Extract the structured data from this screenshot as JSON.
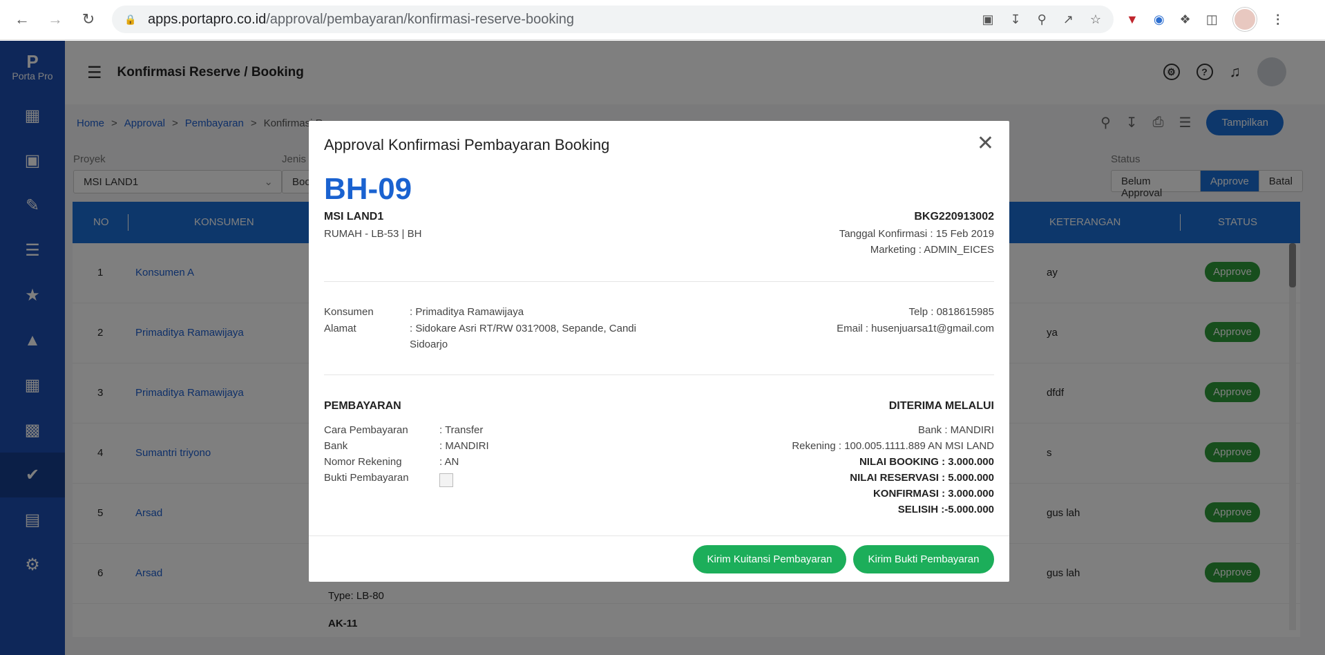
{
  "browser": {
    "url_host": "apps.portapro.co.id",
    "url_path": "/approval/pembayaran/konfirmasi-reserve-booking"
  },
  "app": {
    "logo_mark": "P",
    "logo_name": "Porta Pro",
    "page_title": "Konfirmasi Reserve / Booking"
  },
  "breadcrumb": [
    "Home",
    "Approval",
    "Pembayaran",
    "Konfirmasi R"
  ],
  "toolbar": {
    "tampilkan": "Tampilkan"
  },
  "filters": {
    "proyek_label": "Proyek",
    "proyek_value": "MSI LAND1",
    "jenis_label": "Jenis",
    "jenis_value": "Boo",
    "status_label": "Status",
    "status_options": [
      "Belum Approval",
      "Approve",
      "Batal"
    ],
    "status_selected": "Approve"
  },
  "table": {
    "headers": {
      "no": "NO",
      "konsumen": "KONSUMEN",
      "keterangan": "KETERANGAN",
      "status": "STATUS"
    },
    "rows": [
      {
        "no": "1",
        "konsumen": "Konsumen A",
        "ket": "ay",
        "status": "Approve"
      },
      {
        "no": "2",
        "konsumen": "Primaditya Ramawijaya",
        "ket": "ya",
        "status": "Approve"
      },
      {
        "no": "3",
        "konsumen": "Primaditya Ramawijaya",
        "ket": "dfdf",
        "status": "Approve"
      },
      {
        "no": "4",
        "konsumen": "Sumantri triyono",
        "ket": "s",
        "status": "Approve"
      },
      {
        "no": "5",
        "konsumen": "Arsad",
        "ket": "gus lah",
        "status": "Approve"
      },
      {
        "no": "6",
        "konsumen": "Arsad",
        "ket": "gus lah",
        "status": "Approve"
      }
    ],
    "row6_type": "Type: LB-80",
    "row7_unit": "AK-11"
  },
  "modal": {
    "title": "Approval Konfirmasi Pembayaran Booking",
    "unit_code": "BH-09",
    "project": "MSI LAND1",
    "unit_detail": "RUMAH - LB-53 | BH",
    "booking_no": "BKG220913002",
    "tanggal": "Tanggal Konfirmasi : 15 Feb 2019",
    "marketing": "Marketing : ADMIN_EICES",
    "konsumen_label": "Konsumen",
    "konsumen_value": ": Primaditya Ramawijaya",
    "alamat_label": "Alamat",
    "alamat_line1": ": Sidokare Asri RT/RW 031?008, Sepande, Candi",
    "alamat_line2": "Sidoarjo",
    "telp": "Telp : 0818615985",
    "email": "Email : husenjuarsa1t@gmail.com",
    "pembayaran_heading": "PEMBAYARAN",
    "cara_label": "Cara Pembayaran",
    "cara_value": ": Transfer",
    "bank_label": "Bank",
    "bank_value": ": MANDIRI",
    "rek_label": "Nomor Rekening",
    "rek_value": ": AN",
    "bukti_label": "Bukti Pembayaran",
    "diterima_heading": "DITERIMA MELALUI",
    "d_bank": "Bank : MANDIRI",
    "d_rekening": "Rekening : 100.005.1111.889 AN MSI LAND",
    "nilai_booking": "NILAI BOOKING : 3.000.000",
    "nilai_reservasi": "NILAI RESERVASI : 5.000.000",
    "konfirmasi": "KONFIRMASI : 3.000.000",
    "selisih": "SELISIH :-5.000.000",
    "btn_kuitansi": "Kirim Kuitansi Pembayaran",
    "btn_bukti": "Kirim Bukti Pembayaran"
  }
}
